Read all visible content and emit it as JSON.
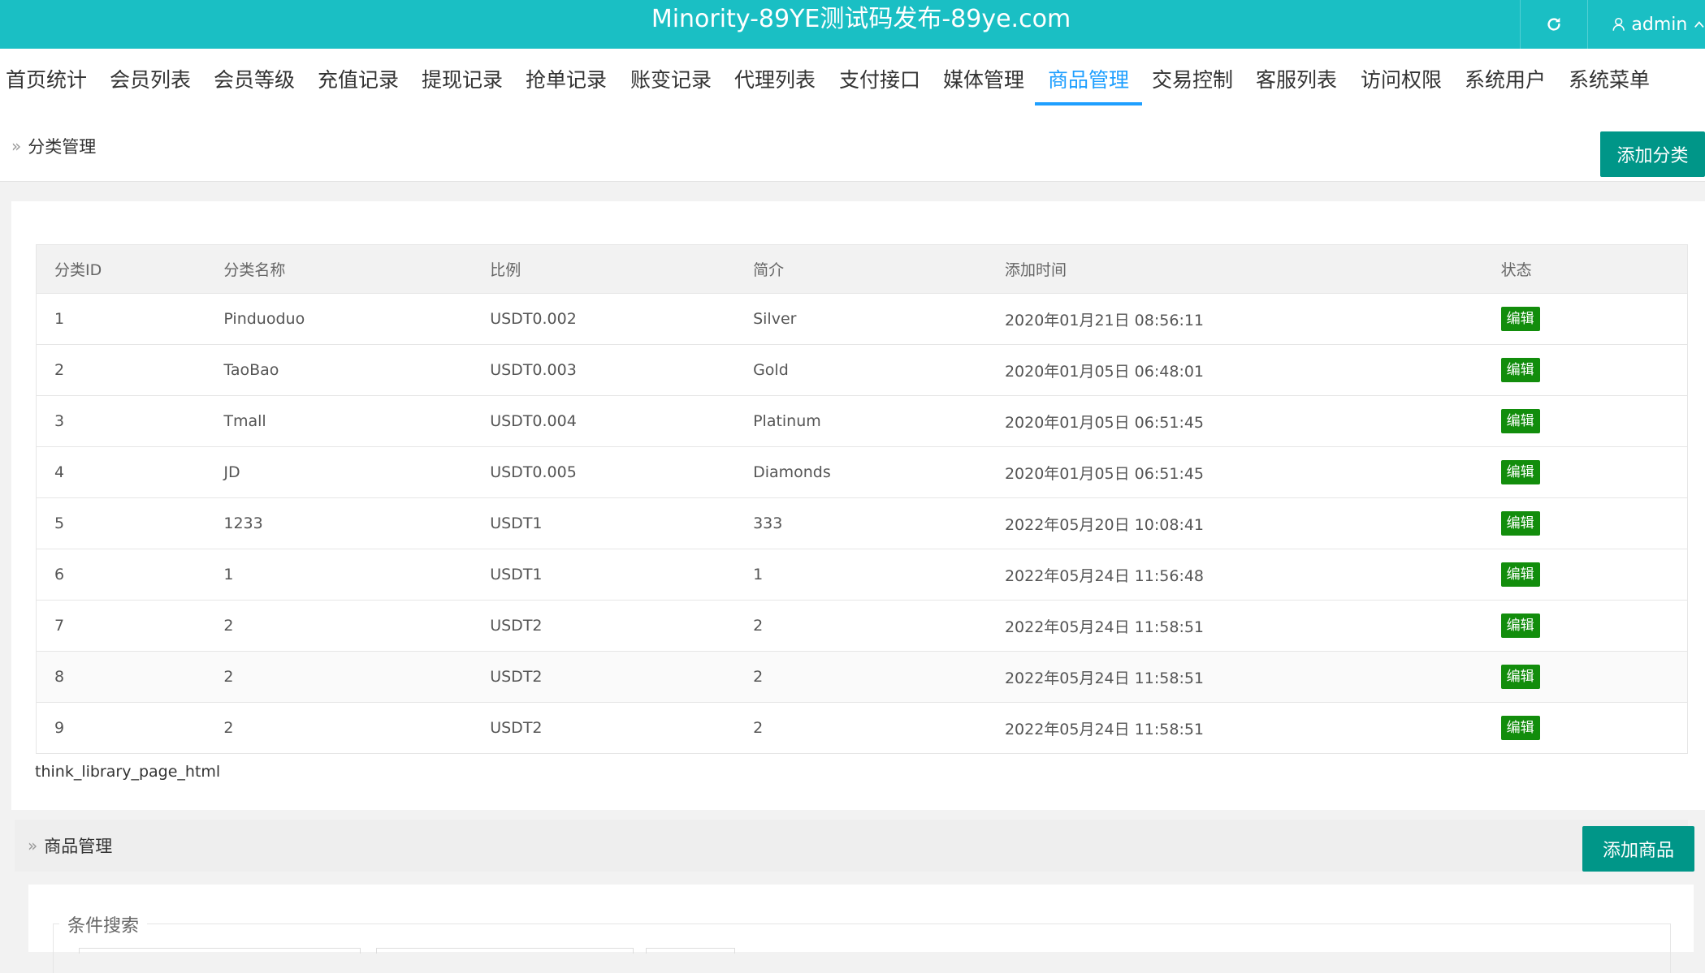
{
  "header": {
    "title": "Minority-89YE测试码发布-89ye.com",
    "refresh_icon": "refresh-icon",
    "user_icon": "user-icon",
    "username": "admin",
    "caret_icon": "chevron-up-icon"
  },
  "nav": {
    "active_index": 10,
    "items": [
      "首页统计",
      "会员列表",
      "会员等级",
      "充值记录",
      "提现记录",
      "抢单记录",
      "账变记录",
      "代理列表",
      "支付接口",
      "媒体管理",
      "商品管理",
      "交易控制",
      "客服列表",
      "访问权限",
      "系统用户",
      "系统菜单"
    ]
  },
  "category_section": {
    "title": "分类管理",
    "add_button": "添加分类",
    "columns": [
      "分类ID",
      "分类名称",
      "比例",
      "简介",
      "添加时间",
      "状态"
    ],
    "rows": [
      [
        "1",
        "Pinduoduo",
        "USDT0.002",
        "Silver",
        "2020年01月21日 08:56:11",
        "编辑"
      ],
      [
        "2",
        "TaoBao",
        "USDT0.003",
        "Gold",
        "2020年01月05日 06:48:01",
        "编辑"
      ],
      [
        "3",
        "Tmall",
        "USDT0.004",
        "Platinum",
        "2020年01月05日 06:51:45",
        "编辑"
      ],
      [
        "4",
        "JD",
        "USDT0.005",
        "Diamonds",
        "2020年01月05日 06:51:45",
        "编辑"
      ],
      [
        "5",
        "1233",
        "USDT1",
        "333",
        "2022年05月20日 10:08:41",
        "编辑"
      ],
      [
        "6",
        "1",
        "USDT1",
        "1",
        "2022年05月24日 11:56:48",
        "编辑"
      ],
      [
        "7",
        "2",
        "USDT2",
        "2",
        "2022年05月24日 11:58:51",
        "编辑"
      ],
      [
        "8",
        "2",
        "USDT2",
        "2",
        "2022年05月24日 11:58:51",
        "编辑"
      ],
      [
        "9",
        "2",
        "USDT2",
        "2",
        "2022年05月24日 11:58:51",
        "编辑"
      ]
    ],
    "pager": "think_library_page_html"
  },
  "goods_section": {
    "title": "商品管理",
    "add_button": "添加商品",
    "search_legend": "条件搜索"
  },
  "colors": {
    "topbar": "#1abfc4",
    "nav_active": "#1e9fff",
    "button": "#009688",
    "badge": "#128d0c"
  }
}
